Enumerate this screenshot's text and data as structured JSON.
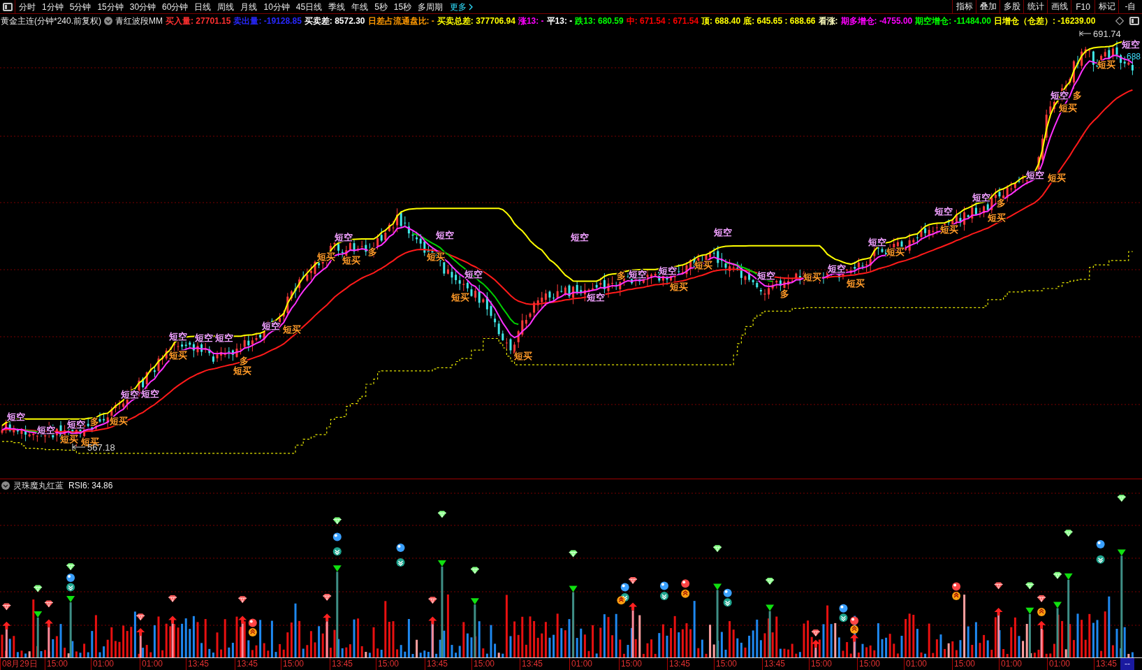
{
  "toolbar": {
    "periods": [
      "分时",
      "1分钟",
      "5分钟",
      "15分钟",
      "30分钟",
      "60分钟",
      "日线",
      "周线",
      "月线",
      "10分钟",
      "45日线",
      "季线",
      "年线",
      "5秒",
      "15秒",
      "多周期"
    ],
    "more": "更多",
    "tools": [
      "指标",
      "叠加",
      "多股",
      "统计",
      "画线",
      "F10",
      "标记",
      "-自"
    ]
  },
  "info_bar": {
    "symbol": "黄金主连(分钟*240.前复权)",
    "indicator": "青红波段MM",
    "readings": [
      {
        "text": "买入量: 27701.15",
        "color": "#ff3030"
      },
      {
        "text": "卖出量: -19128.85",
        "color": "#2828ff"
      },
      {
        "text": "买卖差: 8572.30",
        "color": "#ffffff"
      },
      {
        "text": "日差占流通盘比: -",
        "color": "#ff9900"
      },
      {
        "text": "买卖总差: 377706.94",
        "color": "#ffff00"
      },
      {
        "text": "涨13: -",
        "color": "#ff00ff"
      },
      {
        "text": "平13: -",
        "color": "#ffffff"
      },
      {
        "text": "跌13: 680.59",
        "color": "#00ff00"
      },
      {
        "text": "中: 671.54 : 671.54",
        "color": "#ff0000"
      },
      {
        "text": "顶: 688.40",
        "color": "#ffff00"
      },
      {
        "text": "底: 645.65 : 688.66",
        "color": "#ffff00"
      },
      {
        "text": "看涨:",
        "color": "#ffffc0"
      },
      {
        "text": "期多增仓: -4755.00",
        "color": "#ff00ff"
      },
      {
        "text": "期空增仓: -11484.00",
        "color": "#00ff00"
      },
      {
        "text": "日增仓（仓差）: -16239.00",
        "color": "#ffff00"
      }
    ]
  },
  "main_chart": {
    "high_label": "691.74",
    "low_label": "567.18",
    "edge_label": "688",
    "annotations": [
      {
        "text": "短空",
        "color": "#f0a0ff"
      },
      {
        "text": "短空",
        "color": "#f0a0ff"
      },
      {
        "text": "短买",
        "color": "#ff9a28"
      },
      {
        "text": "短空",
        "color": "#f0a0ff"
      },
      {
        "text": "多",
        "color": "#ff9a28"
      },
      {
        "text": "短买",
        "color": "#ff9a28"
      },
      {
        "text": "短买",
        "color": "#ff9a28"
      },
      {
        "text": "短空",
        "color": "#f0a0ff"
      },
      {
        "text": "短空",
        "color": "#f0a0ff"
      },
      {
        "text": "短空",
        "color": "#f0a0ff"
      },
      {
        "text": "短买",
        "color": "#ff9a28"
      },
      {
        "text": "短空",
        "color": "#f0a0ff"
      },
      {
        "text": "短空",
        "color": "#f0a0ff"
      },
      {
        "text": "多",
        "color": "#ff9a28"
      },
      {
        "text": "短买",
        "color": "#ff9a28"
      },
      {
        "text": "短空",
        "color": "#f0a0ff"
      },
      {
        "text": "短买",
        "color": "#ff9a28"
      },
      {
        "text": "短空",
        "color": "#f0a0ff"
      },
      {
        "text": "短买",
        "color": "#ff9a28"
      },
      {
        "text": "短买",
        "color": "#ff9a28"
      },
      {
        "text": "多",
        "color": "#ff9a28"
      },
      {
        "text": "短空",
        "color": "#f0a0ff"
      },
      {
        "text": "短买",
        "color": "#ff9a28"
      },
      {
        "text": "短空",
        "color": "#f0a0ff"
      },
      {
        "text": "短买",
        "color": "#ff9a28"
      },
      {
        "text": "短买",
        "color": "#ff9a28"
      },
      {
        "text": "短空",
        "color": "#f0a0ff"
      },
      {
        "text": "短空",
        "color": "#f0a0ff"
      },
      {
        "text": "多",
        "color": "#ff9a28"
      },
      {
        "text": "短空",
        "color": "#f0a0ff"
      },
      {
        "text": "短空",
        "color": "#f0a0ff"
      },
      {
        "text": "短买",
        "color": "#ff9a28"
      },
      {
        "text": "短空",
        "color": "#f0a0ff"
      },
      {
        "text": "短买",
        "color": "#ff9a28"
      },
      {
        "text": "短空",
        "color": "#f0a0ff"
      },
      {
        "text": "多",
        "color": "#ff9a28"
      },
      {
        "text": "短买",
        "color": "#ff9a28"
      },
      {
        "text": "短空",
        "color": "#f0a0ff"
      },
      {
        "text": "短买",
        "color": "#ff9a28"
      },
      {
        "text": "短空",
        "color": "#f0a0ff"
      },
      {
        "text": "短买",
        "color": "#ff9a28"
      },
      {
        "text": "短空",
        "color": "#f0a0ff"
      },
      {
        "text": "短买",
        "color": "#ff9a28"
      },
      {
        "text": "短空",
        "color": "#f0a0ff"
      },
      {
        "text": "多",
        "color": "#ff9a28"
      },
      {
        "text": "短买",
        "color": "#ff9a28"
      },
      {
        "text": "短空",
        "color": "#f0a0ff"
      },
      {
        "text": "短买",
        "color": "#ff9a28"
      },
      {
        "text": "短空",
        "color": "#f0a0ff"
      },
      {
        "text": "多",
        "color": "#ff9a28"
      },
      {
        "text": "短买",
        "color": "#ff9a28"
      },
      {
        "text": "短买",
        "color": "#ff9a28"
      },
      {
        "text": "短空",
        "color": "#f0a0ff"
      }
    ]
  },
  "sub_panel": {
    "title": "灵珠魔丸红蓝",
    "reading": "RSI6: 34.86"
  },
  "time_axis": {
    "labels": [
      "08月29日",
      "15:00",
      "01:00",
      "01:00",
      "13:45",
      "13:45",
      "15:00",
      "13:45",
      "15:00",
      "13:45",
      "15:00",
      "13:45",
      "01:00",
      "15:00",
      "13:45",
      "15:00",
      "13:45",
      "15:00",
      "15:00",
      "01:00",
      "15:00",
      "01:00",
      "01:00",
      "13:45"
    ],
    "cursor": "--"
  }
}
